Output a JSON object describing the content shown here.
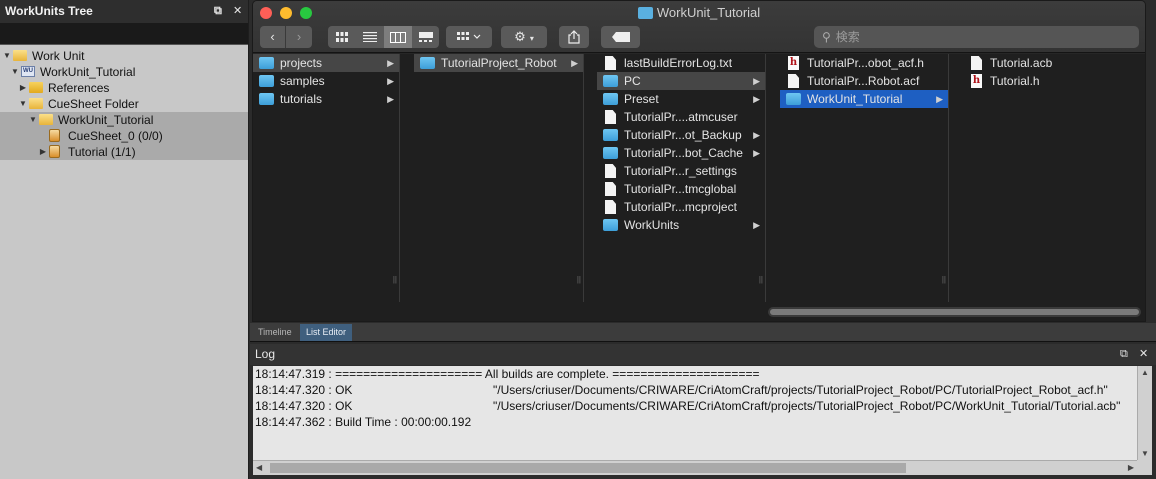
{
  "tree": {
    "title": "WorkUnits Tree",
    "header_icons": [
      "restore-icon",
      "close-icon"
    ],
    "items": [
      {
        "label": "Work Unit",
        "icon": "folder-open-icon",
        "expanded": true,
        "depth": 0
      },
      {
        "label": "WorkUnit_Tutorial",
        "icon": "workunit-icon",
        "expanded": true,
        "depth": 1
      },
      {
        "label": "References",
        "icon": "folder-icon",
        "expanded": false,
        "depth": 2
      },
      {
        "label": "CueSheet Folder",
        "icon": "folder-open-icon",
        "expanded": true,
        "depth": 2
      },
      {
        "label": "WorkUnit_Tutorial",
        "icon": "folder-open-icon",
        "expanded": true,
        "depth": 3
      },
      {
        "label": "CueSheet_0 (0/0)",
        "icon": "cuesheet-icon",
        "expanded": null,
        "depth": 4
      },
      {
        "label": "Tutorial (1/1)",
        "icon": "cuesheet-icon",
        "expanded": false,
        "depth": 4
      }
    ]
  },
  "finder": {
    "title": "WorkUnit_Tutorial",
    "search_placeholder": "検索",
    "toolbar": {
      "nav_back": "‹",
      "nav_forward": "›",
      "view_icons": [
        "icon-view-icon",
        "list-view-icon",
        "column-view-icon",
        "gallery-view-icon"
      ],
      "active_view": "column-view-icon"
    },
    "columns": [
      {
        "items": [
          {
            "label": "projects",
            "type": "folder",
            "has_children": true,
            "selected": "gray"
          },
          {
            "label": "samples",
            "type": "folder",
            "has_children": true
          },
          {
            "label": "tutorials",
            "type": "folder",
            "has_children": true
          }
        ]
      },
      {
        "items": [
          {
            "label": "TutorialProject_Robot",
            "type": "folder",
            "has_children": true,
            "selected": "gray"
          }
        ]
      },
      {
        "items": [
          {
            "label": "lastBuildErrorLog.txt",
            "type": "file"
          },
          {
            "label": "PC",
            "type": "folder",
            "has_children": true,
            "selected": "gray"
          },
          {
            "label": "Preset",
            "type": "folder",
            "has_children": true
          },
          {
            "label": "TutorialPr....atmcuser",
            "type": "file"
          },
          {
            "label": "TutorialPr...ot_Backup",
            "type": "folder",
            "has_children": true
          },
          {
            "label": "TutorialPr...bot_Cache",
            "type": "folder",
            "has_children": true
          },
          {
            "label": "TutorialPr...r_settings",
            "type": "file"
          },
          {
            "label": "TutorialPr...tmcglobal",
            "type": "file"
          },
          {
            "label": "TutorialPr...mcproject",
            "type": "file"
          },
          {
            "label": "WorkUnits",
            "type": "folder",
            "has_children": true
          }
        ]
      },
      {
        "items": [
          {
            "label": "TutorialPr...obot_acf.h",
            "type": "header"
          },
          {
            "label": "TutorialPr...Robot.acf",
            "type": "file"
          },
          {
            "label": "WorkUnit_Tutorial",
            "type": "folder",
            "has_children": true,
            "selected": "blue"
          }
        ]
      },
      {
        "items": [
          {
            "label": "Tutorial.acb",
            "type": "file"
          },
          {
            "label": "Tutorial.h",
            "type": "header"
          }
        ]
      }
    ]
  },
  "tabs": [
    {
      "label": "Timeline",
      "active": false
    },
    {
      "label": "List Editor",
      "active": true
    }
  ],
  "log": {
    "title": "Log",
    "lines": [
      {
        "text": "18:14:47.319 : ===================== All builds are complete. =====================",
        "path": ""
      },
      {
        "text": "18:14:47.320 : OK",
        "path": "\"/Users/criuser/Documents/CRIWARE/CriAtomCraft/projects/TutorialProject_Robot/PC/TutorialProject_Robot_acf.h\""
      },
      {
        "text": "18:14:47.320 : OK",
        "path": "\"/Users/criuser/Documents/CRIWARE/CriAtomCraft/projects/TutorialProject_Robot/PC/WorkUnit_Tutorial/Tutorial.acb\""
      },
      {
        "text": "18:14:47.362 : Build Time : 00:00:00.192",
        "path": ""
      }
    ]
  },
  "colors": {
    "selection_blue": "#1e5fc2",
    "folder_blue": "#5ab0e0",
    "tree_bg": "#c8c8c8",
    "active_tab": "#3f5f7e"
  }
}
